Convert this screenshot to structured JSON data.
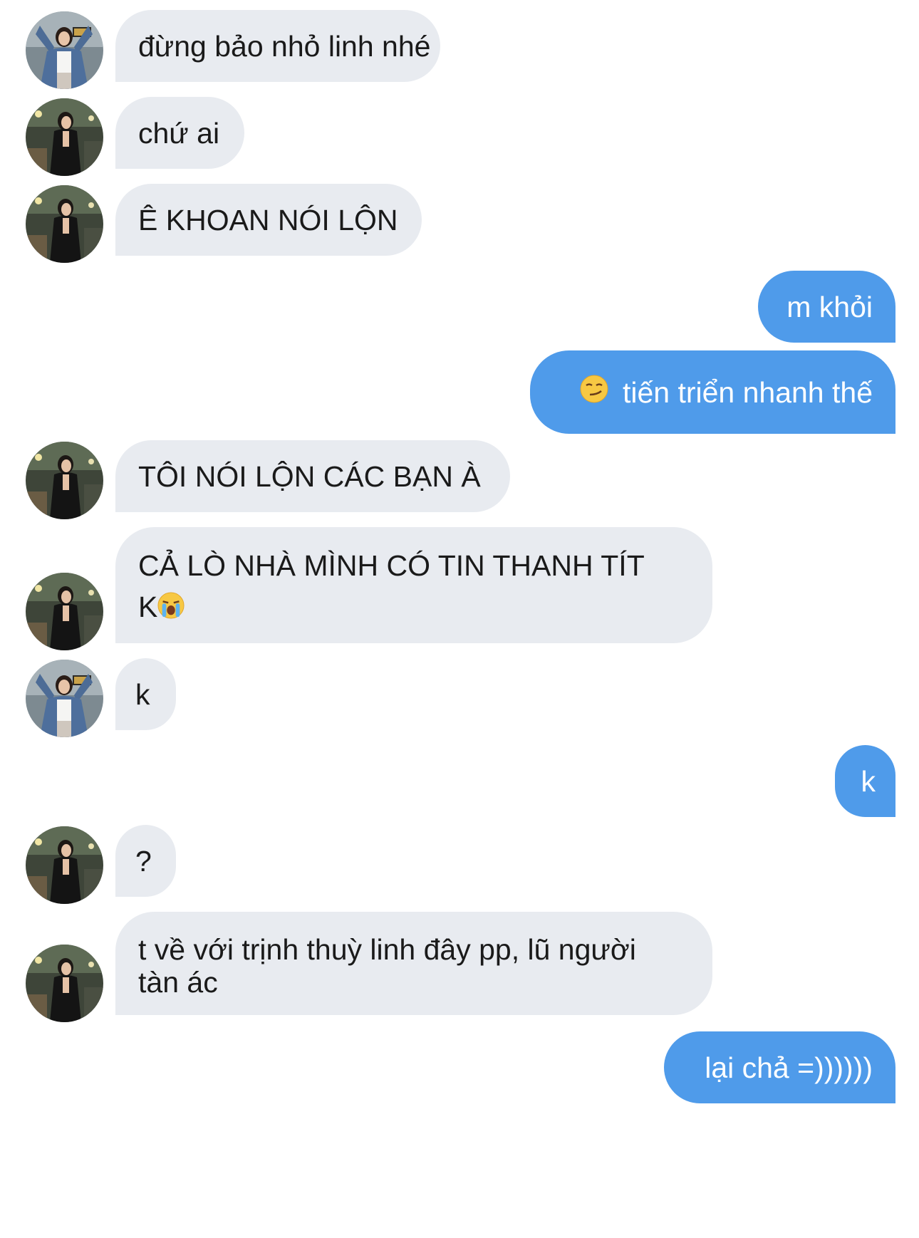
{
  "contacts": {
    "girl_denim": {
      "avatar_icon": "avatar-girl-denim-jacket-icon"
    },
    "girl_black": {
      "avatar_icon": "avatar-girl-black-dress-icon"
    }
  },
  "messages": [
    {
      "sender": "girl_denim",
      "text": "đừng bảo nhỏ linh nhé"
    },
    {
      "sender": "girl_black",
      "text": "chứ ai"
    },
    {
      "sender": "girl_black",
      "text": "Ê KHOAN NÓI LỘN"
    },
    {
      "sender": "me",
      "text": "m khỏi"
    },
    {
      "sender": "me",
      "emoji": "smirking-face-emoji",
      "text": "tiến triển nhanh thế"
    },
    {
      "sender": "girl_black",
      "text": "TÔI NÓI LỘN CÁC BẠN À"
    },
    {
      "sender": "girl_black",
      "line1": "CẢ LÒ NHÀ MÌNH CÓ TIN THANH TÍT",
      "line2": "K",
      "emoji": "loudly-crying-face-emoji"
    },
    {
      "sender": "girl_denim",
      "text": "k"
    },
    {
      "sender": "me",
      "text": "k"
    },
    {
      "sender": "girl_black",
      "text": "?"
    },
    {
      "sender": "girl_black",
      "line1": "t về với trịnh thuỳ linh đây pp, lũ người",
      "line2": "tàn ác"
    },
    {
      "sender": "me",
      "text": "lại chả =))))))"
    }
  ],
  "colors": {
    "incoming_bubble": "#e8ebf0",
    "outgoing_bubble": "#4f9bea",
    "incoming_text": "#1a1a1a",
    "outgoing_text": "#ffffff"
  }
}
